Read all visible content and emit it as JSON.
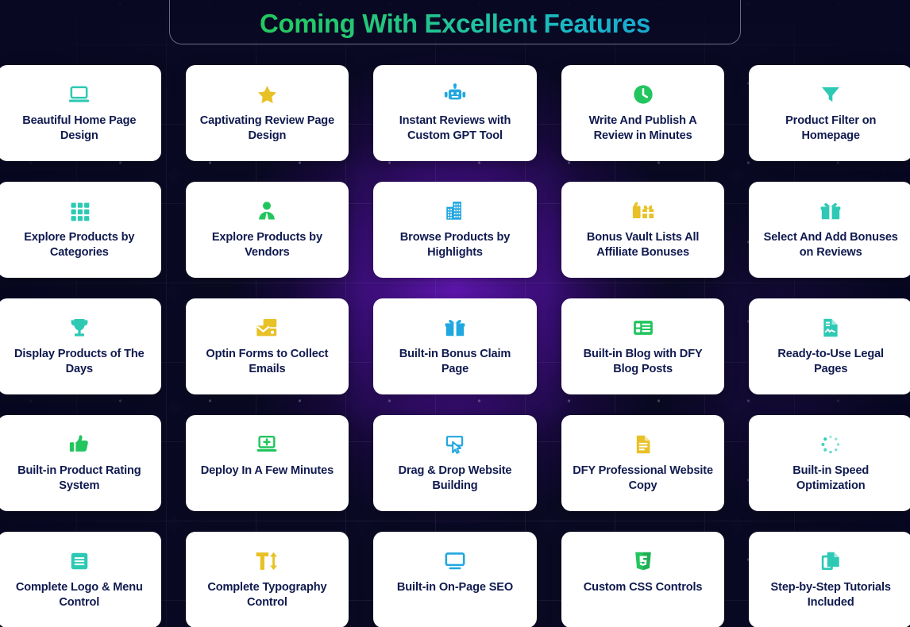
{
  "header": {
    "title": "Coming With Excellent Features",
    "title_gradient_from": "#22c95e",
    "title_gradient_to": "#18a9cf"
  },
  "theme": {
    "background": "#0a0a24",
    "card_background": "#ffffff",
    "card_text": "#101a4f",
    "accent_teal": "#2ec9b4",
    "accent_green": "#22c55e",
    "accent_blue": "#21a7e0",
    "accent_yellow": "#e8c127"
  },
  "features": [
    {
      "icon": "laptop-icon",
      "color": "#2ec9b4",
      "label": "Beautiful Home Page Design"
    },
    {
      "icon": "star-icon",
      "color": "#e8c127",
      "label": "Captivating Review Page Design"
    },
    {
      "icon": "robot-icon",
      "color": "#21a7e0",
      "label": "Instant Reviews with Custom GPT Tool"
    },
    {
      "icon": "clock-icon",
      "color": "#22c55e",
      "label": "Write And Publish A Review in Minutes"
    },
    {
      "icon": "filter-icon",
      "color": "#2ec9b4",
      "label": "Product Filter on Homepage"
    },
    {
      "icon": "grid-icon",
      "color": "#2ec9b4",
      "label": "Explore Products by Categories"
    },
    {
      "icon": "vendor-person-icon",
      "color": "#22c55e",
      "label": "Explore Products by Vendors"
    },
    {
      "icon": "buildings-icon",
      "color": "#21a7e0",
      "label": "Browse Products by Highlights"
    },
    {
      "icon": "gifts-icon",
      "color": "#e8c127",
      "label": "Bonus Vault Lists All Affiliate Bonuses"
    },
    {
      "icon": "gift-icon",
      "color": "#2ec9b4",
      "label": "Select And Add Bonuses on Reviews"
    },
    {
      "icon": "trophy-icon",
      "color": "#2ec9b4",
      "label": "Display Products of The Days"
    },
    {
      "icon": "mail-forms-icon",
      "color": "#e8c127",
      "label": "Optin Forms to Collect Emails"
    },
    {
      "icon": "gift-icon",
      "color": "#21a7e0",
      "label": "Built-in Bonus Claim Page"
    },
    {
      "icon": "blog-list-icon",
      "color": "#22c55e",
      "label": "Built-in Blog with DFY Blog Posts"
    },
    {
      "icon": "legal-doc-icon",
      "color": "#2ec9b4",
      "label": "Ready-to-Use Legal Pages"
    },
    {
      "icon": "thumbs-up-icon",
      "color": "#22c55e",
      "label": "Built-in Product Rating System"
    },
    {
      "icon": "laptop-plus-icon",
      "color": "#22c55e",
      "label": "Deploy In A Few Minutes"
    },
    {
      "icon": "drag-drop-icon",
      "color": "#21a7e0",
      "label": "Drag & Drop Website Building"
    },
    {
      "icon": "document-icon",
      "color": "#e8c127",
      "label": "DFY Professional Website Copy"
    },
    {
      "icon": "spinner-icon",
      "color": "#2ec9b4",
      "label": "Built-in Speed Optimization"
    },
    {
      "icon": "menu-box-icon",
      "color": "#2ec9b4",
      "label": "Complete Logo & Menu Control"
    },
    {
      "icon": "text-height-icon",
      "color": "#e8c127",
      "label": "Complete Typography Control"
    },
    {
      "icon": "monitor-icon",
      "color": "#21a7e0",
      "label": "Built-in On-Page SEO"
    },
    {
      "icon": "css3-shield-icon",
      "color": "#22c55e",
      "label": "Custom CSS Controls"
    },
    {
      "icon": "copy-pages-icon",
      "color": "#2ec9b4",
      "label": "Step-by-Step Tutorials Included"
    }
  ]
}
